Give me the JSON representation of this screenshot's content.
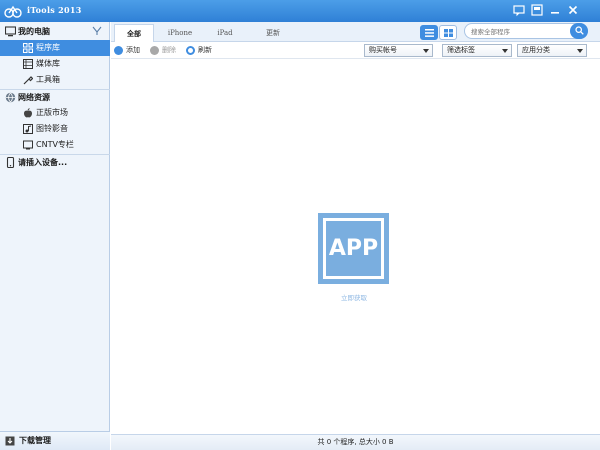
{
  "app": {
    "title": "iTools 2013"
  },
  "sidebar": {
    "groups": [
      {
        "label": "我的电脑",
        "icon": "computer-icon"
      },
      {
        "label": "网络资源",
        "icon": "globe-icon"
      },
      {
        "label": "请插入设备...",
        "icon": "phone-icon"
      }
    ],
    "my_computer_items": [
      {
        "label": "程序库",
        "icon": "apps-grid-icon",
        "active": true
      },
      {
        "label": "媒体库",
        "icon": "media-icon",
        "active": false
      },
      {
        "label": "工具箱",
        "icon": "tools-icon",
        "active": false
      }
    ],
    "network_items": [
      {
        "label": "正版市场",
        "icon": "apple-icon"
      },
      {
        "label": "图铃影音",
        "icon": "music-icon"
      },
      {
        "label": "CNTV专栏",
        "icon": "tv-icon"
      }
    ],
    "download_manager": "下载管理"
  },
  "tabs": [
    {
      "label": "全部",
      "active": true
    },
    {
      "label": "iPhone",
      "active": false
    },
    {
      "label": "iPad",
      "active": false
    },
    {
      "label": "更新",
      "active": false
    }
  ],
  "search": {
    "placeholder": "搜索全部程序"
  },
  "toolbar": {
    "add_label": "添加",
    "delete_label": "删除",
    "refresh_label": "刷新",
    "dropdowns": [
      {
        "selected": "购买帐号"
      },
      {
        "selected": "筛选标签"
      },
      {
        "selected": "应用分类"
      }
    ]
  },
  "empty_state": {
    "icon_text": "APP",
    "link": "立即获取"
  },
  "status": {
    "text": "共 0 个程序, 总大小 0 B"
  },
  "colors": {
    "accent": "#3f8de0",
    "titlebar": "#2f80d6",
    "app_icon": "#7aaedf"
  }
}
